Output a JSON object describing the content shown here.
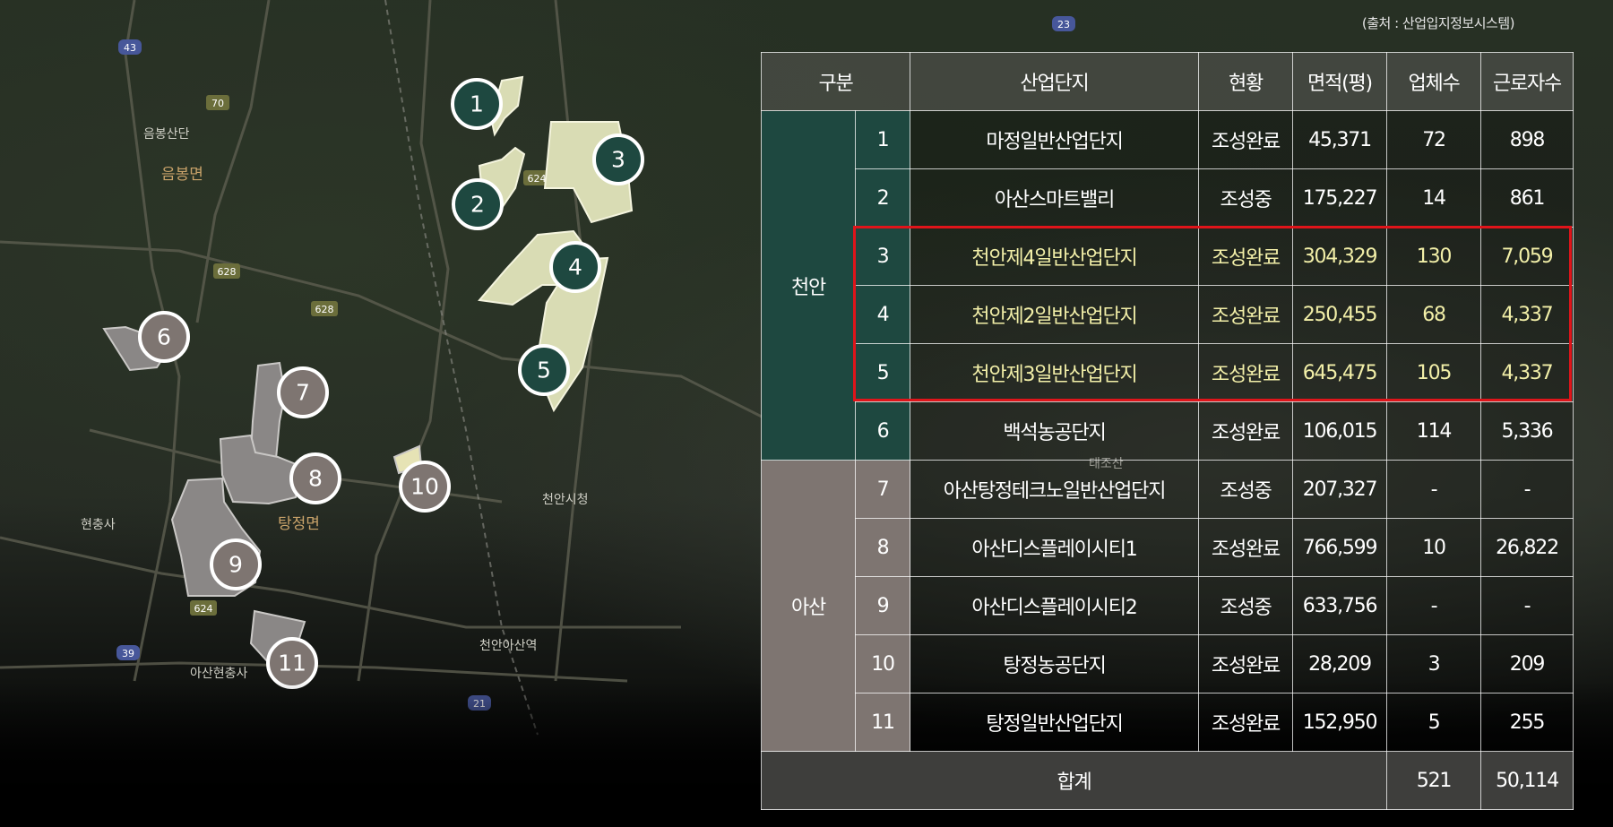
{
  "source_note": "(출처 : 산업입지정보시스템)",
  "colors": {
    "cheonan_group": "#1e4840",
    "asan_group": "#7e7571",
    "highlight_text": "#f2efa8",
    "highlight_border": "#e0141a",
    "cheonan_area_fill": "#d9dcb4",
    "asan_area_fill": "#8a8786"
  },
  "table": {
    "headers": [
      "구분",
      "산업단지",
      "현황",
      "면적(평)",
      "업체수",
      "근로자수"
    ],
    "groups": [
      {
        "name": "천안",
        "rows": [
          {
            "no": "1",
            "name": "마정일반산업단지",
            "status": "조성완료",
            "area": "45,371",
            "companies": "72",
            "workers": "898",
            "highlight": false
          },
          {
            "no": "2",
            "name": "아산스마트밸리",
            "status": "조성중",
            "area": "175,227",
            "companies": "14",
            "workers": "861",
            "highlight": false
          },
          {
            "no": "3",
            "name": "천안제4일반산업단지",
            "status": "조성완료",
            "area": "304,329",
            "companies": "130",
            "workers": "7,059",
            "highlight": true
          },
          {
            "no": "4",
            "name": "천안제2일반산업단지",
            "status": "조성완료",
            "area": "250,455",
            "companies": "68",
            "workers": "4,337",
            "highlight": true
          },
          {
            "no": "5",
            "name": "천안제3일반산업단지",
            "status": "조성완료",
            "area": "645,475",
            "companies": "105",
            "workers": "4,337",
            "highlight": true
          },
          {
            "no": "6",
            "name": "백석농공단지",
            "status": "조성완료",
            "area": "106,015",
            "companies": "114",
            "workers": "5,336",
            "highlight": false
          }
        ]
      },
      {
        "name": "아산",
        "rows": [
          {
            "no": "7",
            "name": "아산탕정테크노일반산업단지",
            "status": "조성중",
            "area": "207,327",
            "companies": "-",
            "workers": "-",
            "highlight": false
          },
          {
            "no": "8",
            "name": "아산디스플레이시티1",
            "status": "조성완료",
            "area": "766,599",
            "companies": "10",
            "workers": "26,822",
            "highlight": false
          },
          {
            "no": "9",
            "name": "아산디스플레이시티2",
            "status": "조성중",
            "area": "633,756",
            "companies": "-",
            "workers": "-",
            "highlight": false
          },
          {
            "no": "10",
            "name": "탕정농공단지",
            "status": "조성완료",
            "area": "28,209",
            "companies": "3",
            "workers": "209",
            "highlight": false
          },
          {
            "no": "11",
            "name": "탕정일반산업단지",
            "status": "조성완료",
            "area": "152,950",
            "companies": "5",
            "workers": "255",
            "highlight": false
          }
        ]
      }
    ],
    "total": {
      "label": "합계",
      "companies": "521",
      "workers": "50,114"
    }
  },
  "map": {
    "place_labels": [
      "음봉산단",
      "음봉면",
      "탕정면",
      "현충사",
      "천안시청",
      "천안아산역",
      "아산현충사",
      "태조산"
    ],
    "road_shields": [
      "43",
      "70",
      "628",
      "628",
      "624",
      "624",
      "39",
      "21",
      "23"
    ],
    "markers": [
      {
        "label": "1",
        "region": "천안"
      },
      {
        "label": "2",
        "region": "천안"
      },
      {
        "label": "3",
        "region": "천안"
      },
      {
        "label": "4",
        "region": "천안"
      },
      {
        "label": "5",
        "region": "천안"
      },
      {
        "label": "6",
        "region": "아산"
      },
      {
        "label": "7",
        "region": "아산"
      },
      {
        "label": "8",
        "region": "아산"
      },
      {
        "label": "9",
        "region": "아산"
      },
      {
        "label": "10",
        "region": "아산"
      },
      {
        "label": "11",
        "region": "아산"
      }
    ]
  }
}
